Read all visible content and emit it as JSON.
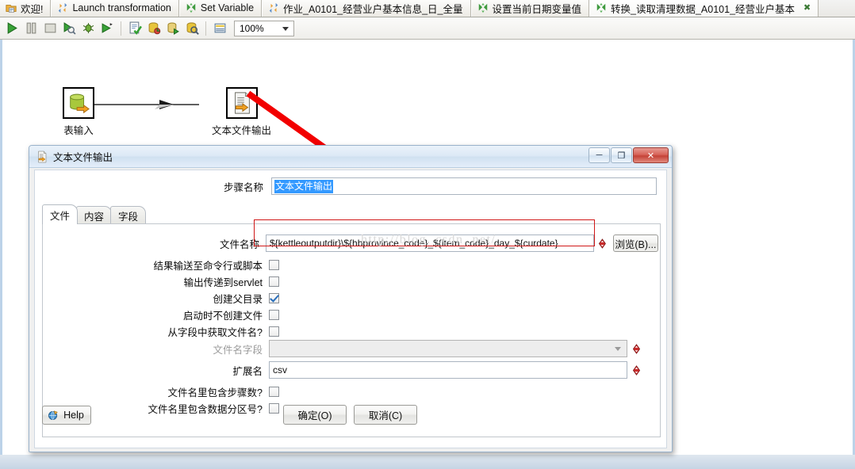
{
  "window": {
    "zoom_level": "100%"
  },
  "tabs": [
    {
      "label": "欢迎!",
      "icon": "welcome-folder-icon",
      "active": false,
      "closable": false
    },
    {
      "label": "Launch transformation",
      "icon": "transformation-icon",
      "active": false,
      "closable": false
    },
    {
      "label": "Set Variable",
      "icon": "job-entry-icon",
      "active": false,
      "closable": false
    },
    {
      "label": "作业_A0101_经营业户基本信息_日_全量",
      "icon": "transformation-icon",
      "active": false,
      "closable": false
    },
    {
      "label": "设置当前日期变量值",
      "icon": "job-entry-icon",
      "active": false,
      "closable": false
    },
    {
      "label": "转换_读取清理数据_A0101_经营业户基本",
      "icon": "job-entry-icon",
      "active": true,
      "closable": true
    }
  ],
  "toolbar": {
    "buttons": [
      {
        "name": "run-icon",
        "title": "Run"
      },
      {
        "name": "pause-icon",
        "title": "Pause"
      },
      {
        "name": "stop-icon",
        "title": "Stop"
      },
      {
        "name": "preview-icon",
        "title": "Preview"
      },
      {
        "name": "debug-icon",
        "title": "Debug"
      },
      {
        "name": "replay-icon",
        "title": "Replay"
      },
      {
        "name": "verify-icon",
        "title": "Verify"
      },
      {
        "name": "impact-icon",
        "title": "Impact analysis"
      },
      {
        "name": "sql-icon",
        "title": "Get SQL"
      },
      {
        "name": "explore-db-icon",
        "title": "Explore database"
      },
      {
        "name": "show-grid-icon",
        "title": "Arrange"
      }
    ],
    "zoom_value": "100%"
  },
  "canvas": {
    "nodes": [
      {
        "label": "表输入",
        "icon": "table-input-icon"
      },
      {
        "label": "文本文件输出",
        "icon": "text-file-output-icon"
      }
    ],
    "annotation": "red-arrow"
  },
  "dialog": {
    "title": "文本文件输出",
    "title_icon": "text-file-output-icon",
    "window_buttons": {
      "minimize": "─",
      "maximize": "❐",
      "close": "✕"
    },
    "step_name": {
      "label": "步骤名称",
      "value": "文本文件输出",
      "selected": true
    },
    "tabs": [
      {
        "label": "文件",
        "active": true
      },
      {
        "label": "内容",
        "active": false
      },
      {
        "label": "字段",
        "active": false
      }
    ],
    "fields": {
      "filename": {
        "label": "文件名称",
        "value": "${kettleoutputdir}\\${hbprovince_code}_${item_code}_day_${curdate}",
        "browse_button": "浏览(B)...",
        "has_variable_indicator": true,
        "highlighted": true
      },
      "filename_field": {
        "label": "文件名字段",
        "value": "",
        "disabled": true,
        "has_variable_indicator": true
      },
      "extension": {
        "label": "扩展名",
        "value": "csv",
        "has_variable_indicator": true
      }
    },
    "checkboxes": [
      {
        "label": "结果输送至命令行或脚本",
        "checked": false
      },
      {
        "label": "输出传递到servlet",
        "checked": false
      },
      {
        "label": "创建父目录",
        "checked": true
      },
      {
        "label": "启动时不创建文件",
        "checked": false
      },
      {
        "label": "从字段中获取文件名?",
        "checked": false
      },
      {
        "label": "文件名里包含步骤数?",
        "checked": false
      },
      {
        "label": "文件名里包含数据分区号?",
        "checked": false
      }
    ],
    "buttons": {
      "help": "Help",
      "ok": "确定(O)",
      "cancel": "取消(C)"
    }
  },
  "watermark": "http://blog. csdn. net/",
  "colors": {
    "accent_blue": "#3399ff",
    "highlight_red": "#d01717",
    "arrow_red": "#f20000",
    "canvas_band": "#bcd2e8"
  }
}
